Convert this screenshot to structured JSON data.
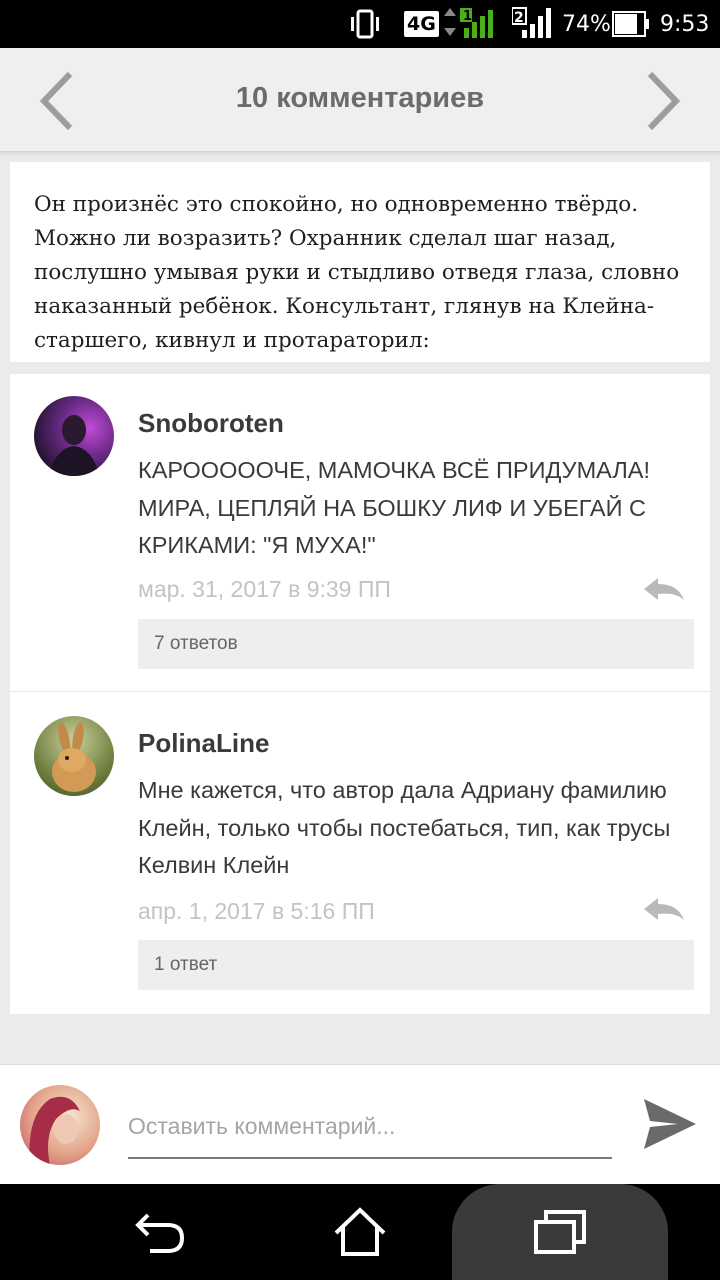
{
  "status_bar": {
    "network_type": "4G",
    "sim1_label": "1",
    "sim2_label": "2",
    "battery_percent": "74%",
    "time": "9:53"
  },
  "header": {
    "title": "10 комментариев",
    "prev_icon": "chevron-left-icon",
    "next_icon": "chevron-right-icon"
  },
  "quote": {
    "text": "Он произнёс это спокойно, но одновременно твёрдо. Можно ли возразить? Охранник сделал шаг назад, послушно умывая руки и стыдливо отведя глаза, словно наказанный ребёнок. Консультант, глянув на Клейна-старшего, кивнул и протараторил:"
  },
  "comments": [
    {
      "author": "Snoboroten",
      "text": "КАРОООООЧЕ, МАМОЧКА ВСЁ ПРИДУМАЛА! МИРА, ЦЕПЛЯЙ НА БОШКУ ЛИФ И УБЕГАЙ С КРИКАМИ: \"Я МУХА!\"",
      "date": "мар. 31, 2017 в 9:39 ПП",
      "replies": "7 ответов"
    },
    {
      "author": "PolinaLine",
      "text": "Мне кажется, что автор дала Адриану фамилию Клейн, только чтобы постебаться, тип, как трусы Келвин Клейн",
      "date": "апр. 1, 2017 в 5:16 ПП",
      "replies": "1 ответ"
    }
  ],
  "compose": {
    "placeholder": "Оставить комментарий...",
    "send_icon": "send-icon"
  },
  "colors": {
    "header_bg": "#efefef",
    "page_bg": "#ebebeb",
    "date_text": "#c3c3c3",
    "replies_bg": "#eeedef"
  }
}
